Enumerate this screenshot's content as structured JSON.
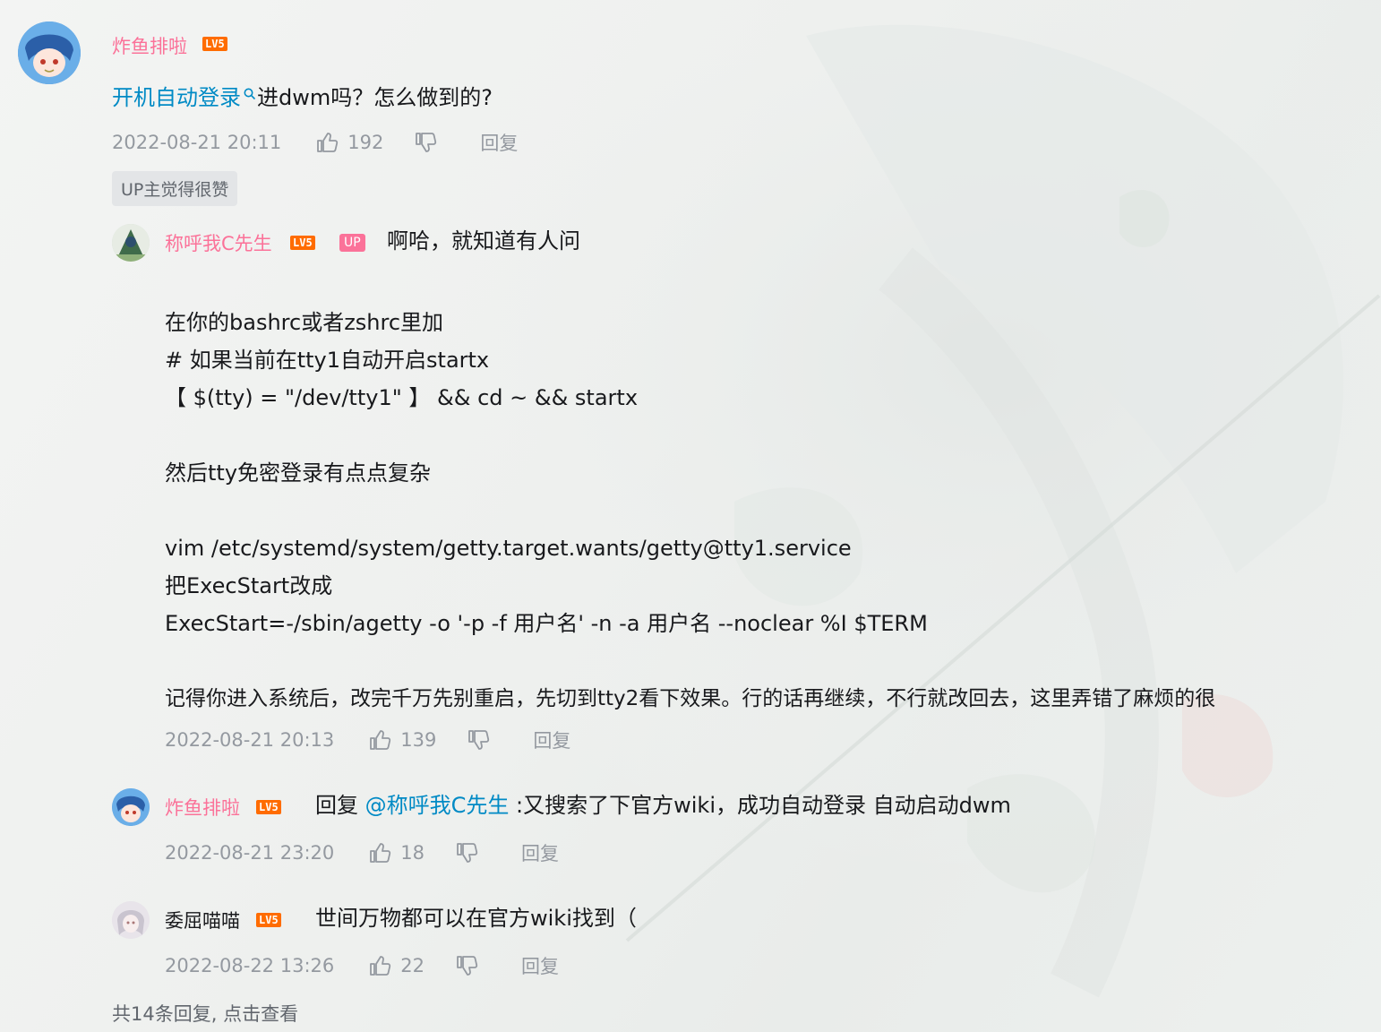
{
  "main_comment": {
    "username": "炸鱼排啦",
    "level": "LV5",
    "text_link": "开机自动登录",
    "text_rest": "进dwm吗？怎么做到的?",
    "time": "2022-08-21 20:11",
    "likes": "192",
    "reply_label": "回复",
    "up_tag": "UP主觉得很赞"
  },
  "replies": [
    {
      "username": "称呼我C先生",
      "level": "LV5",
      "badge": "UP",
      "lines": [
        "啊哈，就知道有人问",
        "",
        "在你的bashrc或者zshrc里加",
        "# 如果当前在tty1自动开启startx",
        "【 $(tty) = \"/dev/tty1\" 】 && cd ~ && startx",
        "",
        "然后tty免密登录有点点复杂",
        "",
        " vim /etc/systemd/system/getty.target.wants/getty@tty1.service",
        "把ExecStart改成",
        "ExecStart=-/sbin/agetty -o '-p -f 用户名' -n -a 用户名 --noclear %I $TERM",
        "",
        "记得你进入系统后，改完千万先别重启，先切到tty2看下效果。行的话再继续，不行就改回去，这里弄错了麻烦的很"
      ],
      "time": "2022-08-21 20:13",
      "likes": "139",
      "reply_label": "回复"
    },
    {
      "username": "炸鱼排啦",
      "level": "LV5",
      "reply_prefix": "回复 ",
      "mention": "@称呼我C先生",
      "text": " :又搜索了下官方wiki，成功自动登录 自动启动dwm",
      "time": "2022-08-21 23:20",
      "likes": "18",
      "reply_label": "回复"
    },
    {
      "username": "委屈喵喵",
      "level": "LV5",
      "text": "世间万物都可以在官方wiki找到（",
      "time": "2022-08-22 13:26",
      "likes": "22",
      "reply_label": "回复"
    }
  ],
  "view_more": "共14条回复, 点击查看",
  "colors": {
    "username_pink": "#fb7299",
    "link_blue": "#008ac5",
    "meta_gray": "#9499a0",
    "level_orange": "#ff6c00"
  }
}
